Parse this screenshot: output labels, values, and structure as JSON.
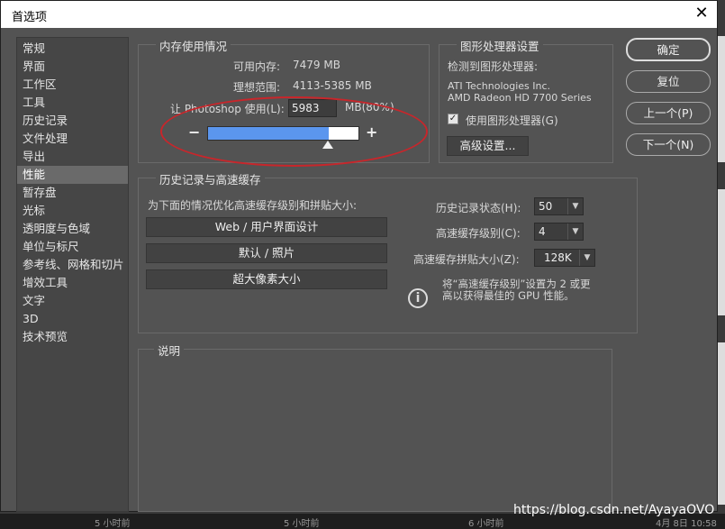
{
  "window": {
    "title": "首选项",
    "close_glyph": "✕"
  },
  "sidebar": {
    "items": [
      {
        "label": "常规"
      },
      {
        "label": "界面"
      },
      {
        "label": "工作区"
      },
      {
        "label": "工具"
      },
      {
        "label": "历史记录"
      },
      {
        "label": "文件处理"
      },
      {
        "label": "导出"
      },
      {
        "label": "性能"
      },
      {
        "label": "暂存盘"
      },
      {
        "label": "光标"
      },
      {
        "label": "透明度与色域"
      },
      {
        "label": "单位与标尺"
      },
      {
        "label": "参考线、网格和切片"
      },
      {
        "label": "增效工具"
      },
      {
        "label": "文字"
      },
      {
        "label": "3D"
      },
      {
        "label": "技术预览"
      }
    ],
    "selected": "性能"
  },
  "memory": {
    "title": "内存使用情况",
    "available_label": "可用内存:",
    "available_value": "7479 MB",
    "ideal_label": "理想范围:",
    "ideal_value": "4113-5385 MB",
    "let_label": "让 Photoshop 使用(L):",
    "use_value": "5983",
    "unit_pct": "MB(80%)",
    "minus": "−",
    "plus": "+",
    "slider_fraction": 0.8
  },
  "gpu": {
    "title": "图形处理器设置",
    "detected_label": "检测到图形处理器:",
    "vendor": "ATI Technologies Inc.",
    "model": "AMD Radeon HD 7700 Series",
    "use_gpu_label": "使用图形处理器(G)",
    "use_gpu_checked": true,
    "advanced_button": "高级设置..."
  },
  "history_cache": {
    "title": "历史记录与高速缓存",
    "optimize_label": "为下面的情况优化高速缓存级别和拼贴大小:",
    "preset_buttons": [
      "Web / 用户界面设计",
      "默认 / 照片",
      "超大像素大小"
    ],
    "history_states_label": "历史记录状态(H):",
    "history_states_value": "50",
    "cache_levels_label": "高速缓存级别(C):",
    "cache_levels_value": "4",
    "tile_size_label": "高速缓存拼贴大小(Z):",
    "tile_size_value": "128K",
    "info_text_1": "将“高速缓存级别”设置为 2 或更",
    "info_text_2": "高以获得最佳的 GPU 性能。"
  },
  "description": {
    "title": "说明"
  },
  "buttons": {
    "ok": "确定",
    "reset": "复位",
    "prev": "上一个(P)",
    "next": "下一个(N)"
  },
  "taskbar": {
    "items": [
      "5 小时前",
      "5 小时前",
      "6 小时前",
      "4月 8日 10:58"
    ]
  },
  "watermark": "https://blog.csdn.net/AyayaOVO",
  "colors": {
    "slider_fill": "#5b96ee",
    "annotation": "#c8262b",
    "dialog_bg": "#535353"
  }
}
